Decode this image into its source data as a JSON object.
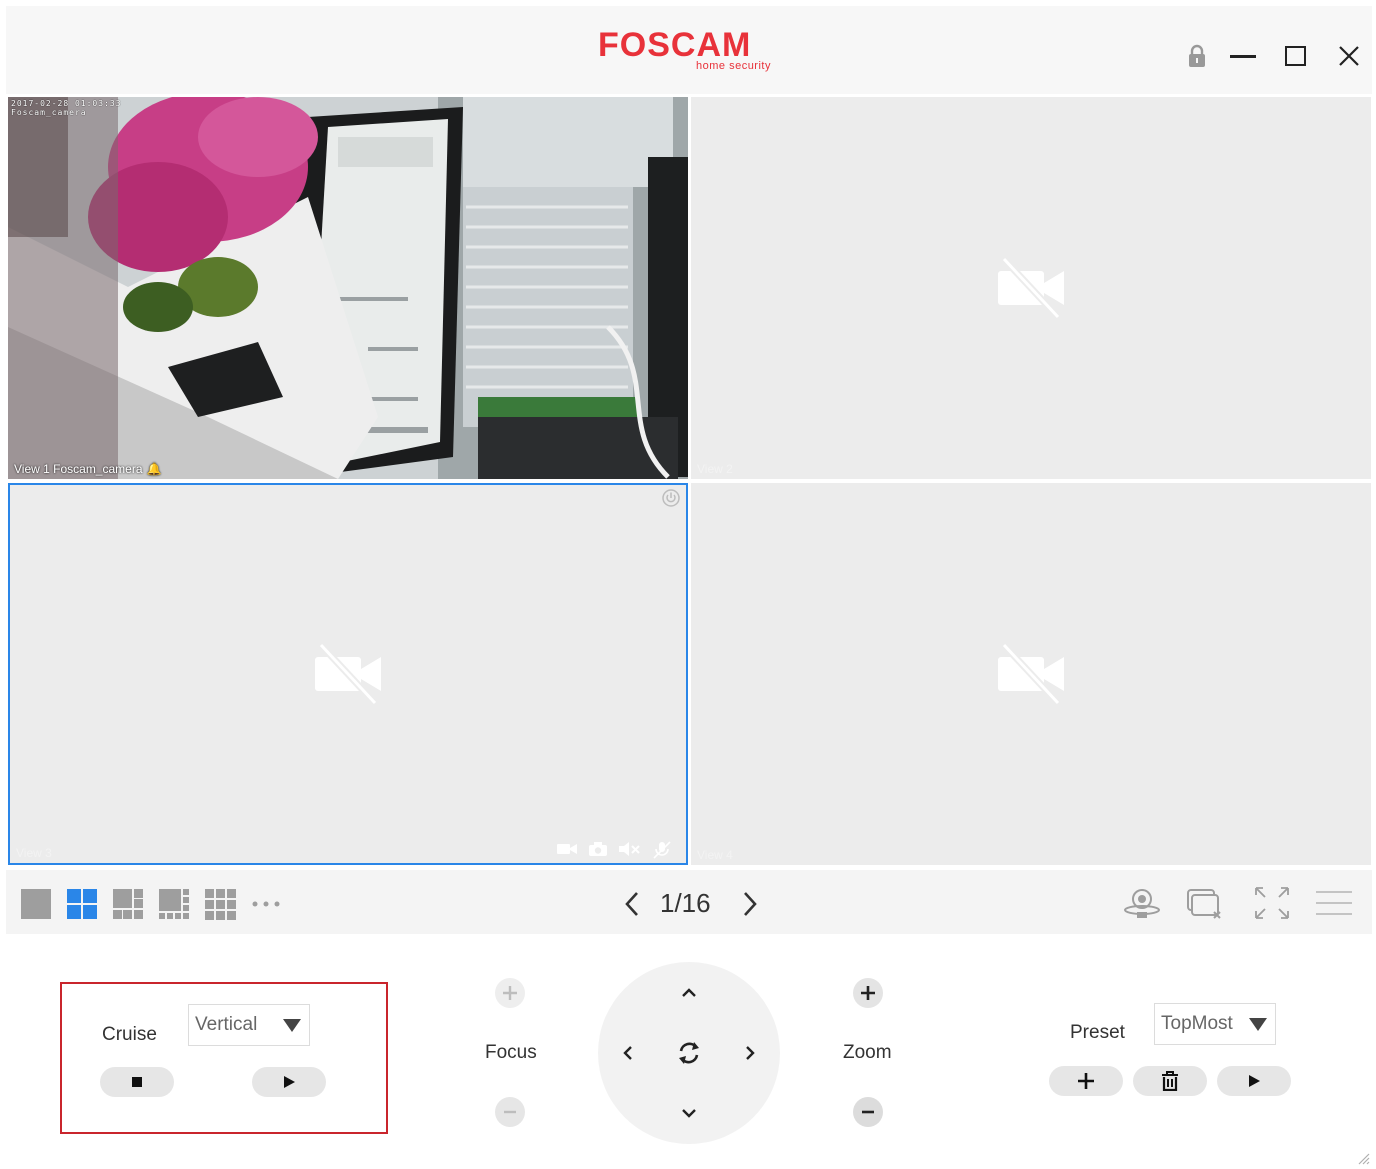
{
  "app": {
    "brand": "FOSCAM",
    "tagline": "home security",
    "colors": {
      "brand": "#e8323a",
      "accent": "#2a86e8",
      "highlight": "#c9252c"
    }
  },
  "window_controls": [
    {
      "name": "lock-icon"
    },
    {
      "name": "minimize-icon"
    },
    {
      "name": "maximize-icon"
    },
    {
      "name": "close-icon"
    }
  ],
  "views": [
    {
      "label": "View 1 Foscam_camera",
      "osd_line1": "2017-02-28 01:03:33",
      "osd_line2": "Foscam_camera",
      "alarm_icon": "bell-icon",
      "state": "live"
    },
    {
      "label": "View 2",
      "state": "no-video",
      "icon": "camera-off-icon"
    },
    {
      "label": "View 3",
      "state": "no-video",
      "icon": "camera-off-icon",
      "selected": true
    },
    {
      "label": "View 4",
      "state": "no-video",
      "icon": "camera-off-icon"
    }
  ],
  "view3_tools": [
    "record-icon",
    "snapshot-icon",
    "mute-icon",
    "talk-off-icon"
  ],
  "toolbar": {
    "layouts": [
      "layout-1-icon",
      "layout-4-icon",
      "layout-6-icon",
      "layout-8-icon",
      "layout-9-icon",
      "more-layouts-icon"
    ],
    "active_layout": "layout-4-icon",
    "page": "1/16",
    "right_tools": [
      "ptz-camera-icon",
      "close-all-views-icon",
      "fullscreen-icon",
      "menu-icon"
    ]
  },
  "ptz": {
    "cruise": {
      "label": "Cruise",
      "selected": "Vertical"
    },
    "focus": {
      "label": "Focus"
    },
    "zoom": {
      "label": "Zoom"
    },
    "preset": {
      "label": "Preset",
      "selected": "TopMost"
    }
  }
}
